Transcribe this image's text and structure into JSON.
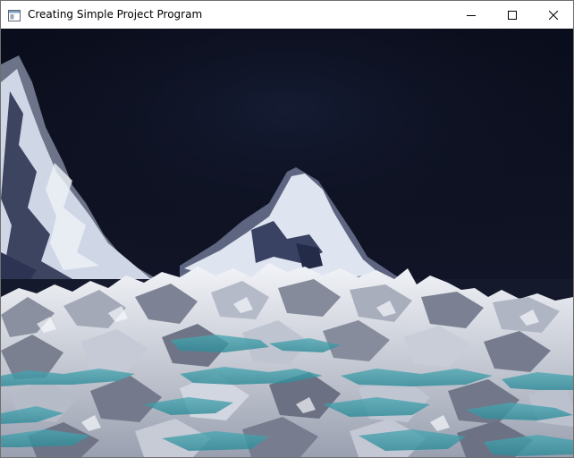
{
  "window": {
    "title": "Creating Simple Project Program"
  },
  "icons": {
    "app": "app-window-icon",
    "minimize": "minimize-icon",
    "maximize": "maximize-icon",
    "close": "close-icon"
  },
  "colors": {
    "sky": "#0d1020",
    "snow": "#d9dde6",
    "rock": "#5a5e6c",
    "water": "#3c9aa6"
  }
}
